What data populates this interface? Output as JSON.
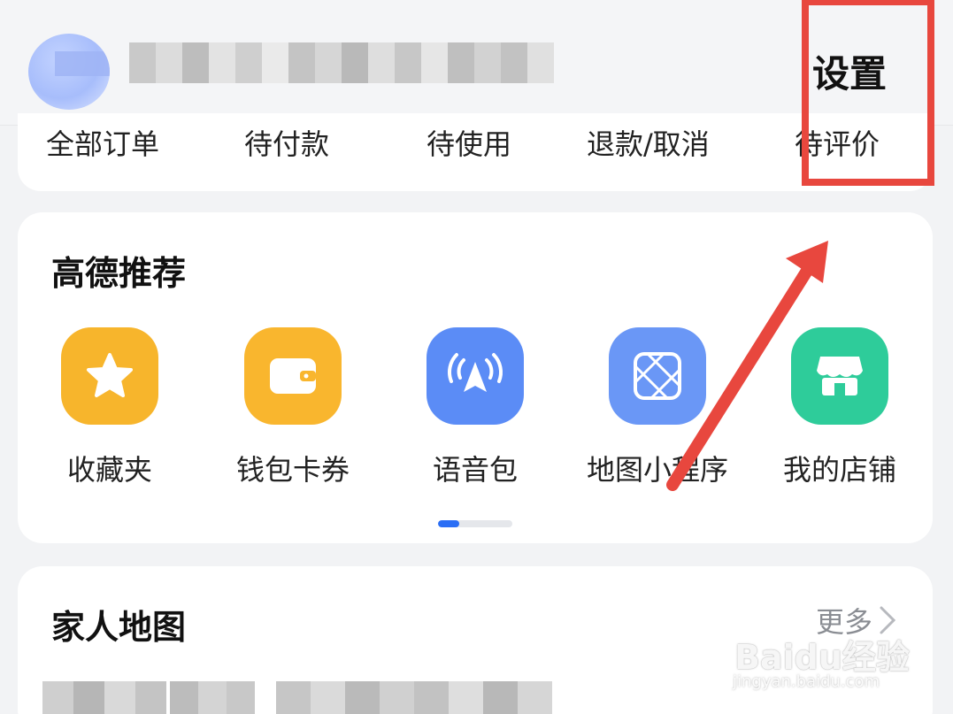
{
  "header": {
    "settings_label": "设置"
  },
  "orders": {
    "items": [
      "全部订单",
      "待付款",
      "待使用",
      "退款/取消",
      "待评价"
    ]
  },
  "recommend": {
    "title": "高德推荐",
    "apps": [
      {
        "label": "收藏夹",
        "icon": "star-icon",
        "color": "#f7b52c"
      },
      {
        "label": "钱包卡券",
        "icon": "wallet-icon",
        "color": "#f9b62e"
      },
      {
        "label": "语音包",
        "icon": "voice-pack-icon",
        "color": "#5b8cf6"
      },
      {
        "label": "地图小程序",
        "icon": "mini-program-icon",
        "color": "#6a97f6"
      },
      {
        "label": "我的店铺",
        "icon": "shop-icon",
        "color": "#2ecc9a"
      }
    ],
    "page_index": 1,
    "page_count": 3
  },
  "family_map": {
    "title": "家人地图",
    "more_label": "更多"
  },
  "watermark": {
    "main": "Baidu经验",
    "sub": "jingyan.baidu.com"
  },
  "colors": {
    "accent_blue": "#2a6ef5",
    "annotation_red": "#e8473e",
    "background": "#f2f3f5",
    "card": "#ffffff"
  }
}
